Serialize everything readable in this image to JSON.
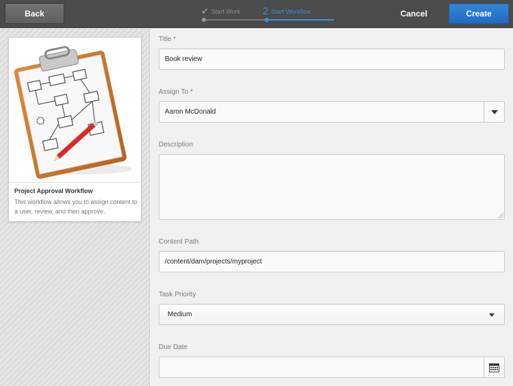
{
  "toolbar": {
    "back_label": "Back",
    "cancel_label": "Cancel",
    "create_label": "Create"
  },
  "wizard": {
    "steps": [
      {
        "label": "Start Work",
        "state": "completed"
      },
      {
        "number": "2",
        "label": "Start Workflow",
        "state": "current"
      }
    ]
  },
  "workflow_card": {
    "title": "Project Approval Workflow",
    "description": "This workflow allows you to assign content to a user, review, and then approve."
  },
  "form": {
    "title": {
      "label": "Title *",
      "value": "Book review"
    },
    "assign_to": {
      "label": "Assign To *",
      "value": "Aaron McDonald"
    },
    "description": {
      "label": "Description",
      "value": ""
    },
    "content_path": {
      "label": "Content Path",
      "value": "/content/dam/projects/myproject"
    },
    "task_priority": {
      "label": "Task Priority",
      "value": "Medium"
    },
    "due_date": {
      "label": "Due Date",
      "value": ""
    }
  },
  "icons": {
    "check": "checkmark-icon",
    "dropdown": "chevron-down-icon",
    "calendar": "calendar-icon"
  },
  "colors": {
    "topbar": "#4b4b4b",
    "accent": "#2469c2",
    "step_active": "#3c8fdc"
  }
}
